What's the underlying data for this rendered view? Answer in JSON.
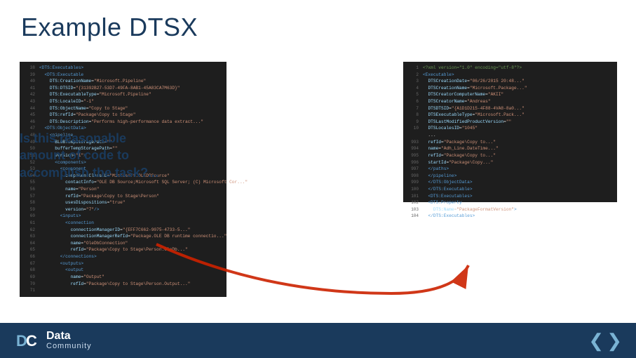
{
  "slide": {
    "title": "Example DTSX",
    "text_block": {
      "line1": "Is this reasonable",
      "line2": "amount of code to",
      "line3": "accomplish the task?..."
    },
    "bottom_bar": {
      "logo_data": "Data",
      "logo_community": "Community",
      "nav_prev": "<",
      "nav_next": ">"
    }
  }
}
